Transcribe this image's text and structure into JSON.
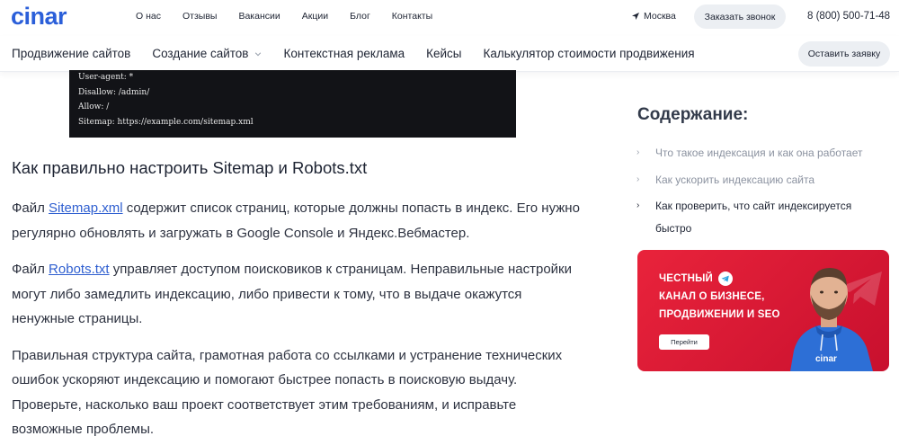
{
  "header": {
    "logo_text": "cinar",
    "nav": [
      "О нас",
      "Отзывы",
      "Вакансии",
      "Акции",
      "Блог",
      "Контакты"
    ],
    "city": "Москва",
    "callback_button": "Заказать звонок",
    "phone": "8 (800) 500-71-48"
  },
  "mainnav": {
    "items": [
      "Продвижение сайтов",
      "Создание сайтов",
      "Контекстная реклама",
      "Кейсы",
      "Калькулятор стоимости продвижения"
    ],
    "leave_request_button": "Оставить заявку"
  },
  "code": {
    "lines": [
      "User-agent: *",
      "Disallow: /admin/",
      "Allow: /",
      "Sitemap: https://example.com/sitemap.xml"
    ]
  },
  "article": {
    "heading": "Как правильно настроить Sitemap и Robots.txt",
    "p1_prefix": "Файл ",
    "p1_link": "Sitemap.xml",
    "p1_rest": " содержит список страниц, которые должны попасть в индекс. Его нужно регулярно обновлять и загружать в Google Console и Яндекс.Вебмастер.",
    "p2_prefix": "Файл ",
    "p2_link": "Robots.txt",
    "p2_rest": " управляет доступом поисковиков к страницам. Неправильные настройки могут либо замедлить индексацию, либо привести к тому, что в выдаче окажутся ненужные страницы.",
    "p3": "Правильная структура сайта, грамотная работа со ссылками и устранение технических ошибок ускоряют индексацию и помогают быстрее попасть в поисковую выдачу. Проверьте, насколько ваш проект соответствует этим требованиям, и исправьте возможные проблемы."
  },
  "toc": {
    "title": "Содержание:",
    "items": [
      "Что такое индексация и как она работает",
      "Как ускорить индексацию сайта",
      "Как проверить, что сайт индексируется быстро"
    ]
  },
  "banner": {
    "line1": "ЧЕСТНЫЙ",
    "line2": "КАНАЛ О БИЗНЕСЕ,",
    "line3": "ПРОДВИЖЕНИИ И SEO",
    "button": "Перейти",
    "shirt_logo": "cinar"
  },
  "colors": {
    "accent_link": "#2f5fd0",
    "logo_blue": "#2b5fd9",
    "banner_red": "#e9233b",
    "pill_bg": "#eceff3"
  }
}
